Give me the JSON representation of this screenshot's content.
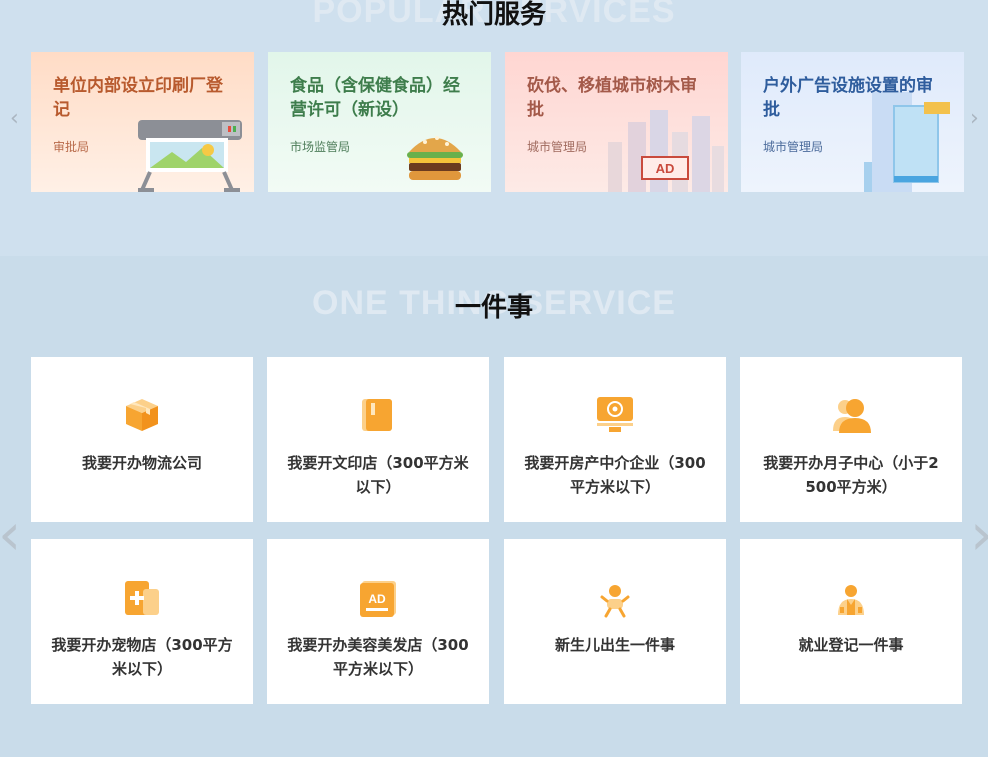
{
  "hot": {
    "title": "热门服务",
    "bg_title": "POPULAR SERVICES",
    "cards": [
      {
        "title": "单位内部设立印刷厂登记",
        "dept": "审批局",
        "icon": "printer-icon",
        "title_color": "#b85a2e",
        "bg": "#ffe6d4"
      },
      {
        "title": "食品（含保健食品）经营许可（新设）",
        "dept": "市场监管局",
        "icon": "burger-icon",
        "title_color": "#3e7d4c",
        "bg": "#e6f7ec"
      },
      {
        "title": "砍伐、移植城市树木审批",
        "dept": "城市管理局",
        "icon": "city-billboard-icon",
        "title_color": "#a45a4a",
        "bg": "#ffe0dc"
      },
      {
        "title": "户外广告设施设置的审批",
        "dept": "城市管理局",
        "icon": "billboard-icon",
        "title_color": "#2f5d9d",
        "bg": "#e4eefb"
      }
    ]
  },
  "one": {
    "title": "一件事",
    "bg_title": "ONE THING SERVICE",
    "items": [
      {
        "label": "我要开办物流公司",
        "icon": "package-icon"
      },
      {
        "label": "我要开文印店（300平方米以下）",
        "icon": "book-icon"
      },
      {
        "label": "我要开房产中介企业（300平方米以下）",
        "icon": "monitor-icon"
      },
      {
        "label": "我要开办月子中心（小于2500平方米）",
        "icon": "person-icon"
      },
      {
        "label": "我要开办宠物店（300平方米以下）",
        "icon": "medical-doc-icon"
      },
      {
        "label": "我要开办美容美发店（300平方米以下）",
        "icon": "ad-icon"
      },
      {
        "label": "新生儿出生一件事",
        "icon": "baby-icon"
      },
      {
        "label": "就业登记一件事",
        "icon": "worker-icon"
      }
    ]
  },
  "colors": {
    "accent_orange": "#f7a531",
    "orange_light": "#fcd08a"
  }
}
